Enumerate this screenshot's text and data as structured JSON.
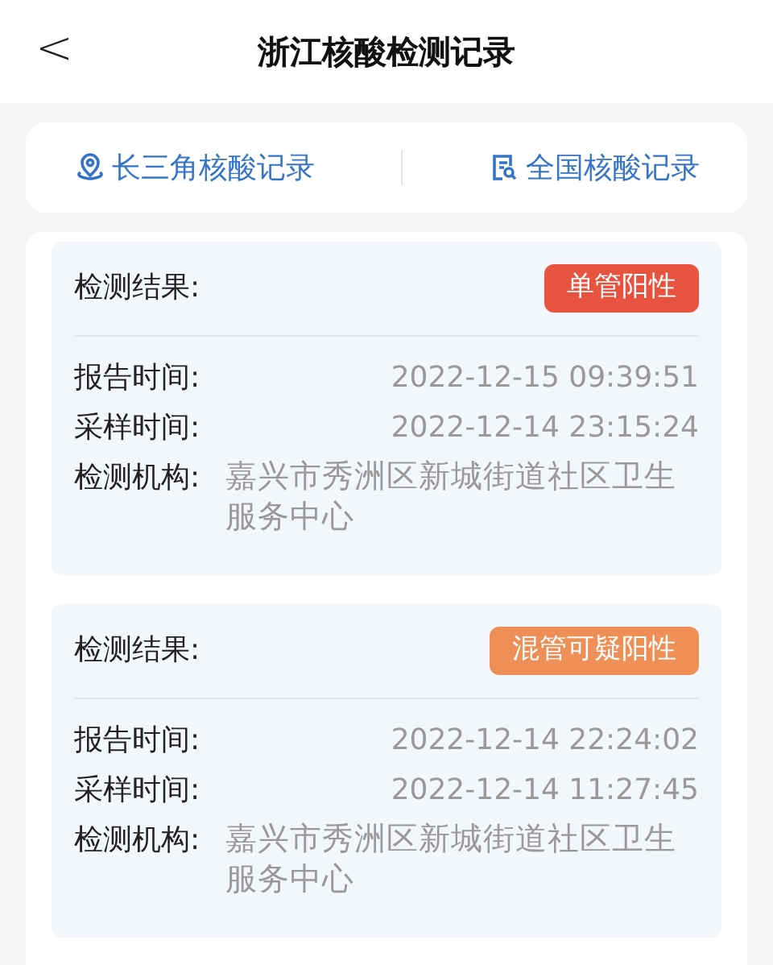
{
  "header": {
    "back": "<",
    "title": "浙江核酸检测记录"
  },
  "tabs": [
    {
      "label": "长三角核酸记录",
      "kind": "location"
    },
    {
      "label": "全国核酸记录",
      "kind": "document"
    }
  ],
  "records": [
    {
      "result_label": "检测结果:",
      "result": "单管阳性",
      "color": "#e7533f",
      "fields": [
        {
          "label": "报告时间:",
          "value": "2022-12-15 09:39:51",
          "kind": "time"
        },
        {
          "label": "采样时间:",
          "value": "2022-12-14 23:15:24",
          "kind": "time"
        },
        {
          "label": "检测机构:",
          "value": "嘉兴市秀洲区新城街道社区卫生服务中心",
          "kind": "place"
        }
      ]
    },
    {
      "result_label": "检测结果:",
      "result": "混管可疑阳性",
      "color": "#ee8f57",
      "fields": [
        {
          "label": "报告时间:",
          "value": "2022-12-14 22:24:02",
          "kind": "time"
        },
        {
          "label": "采样时间:",
          "value": "2022-12-14 11:27:45",
          "kind": "time"
        },
        {
          "label": "检测机构:",
          "value": "嘉兴市秀洲区新城街道社区卫生服务中心",
          "kind": "place"
        }
      ]
    }
  ]
}
